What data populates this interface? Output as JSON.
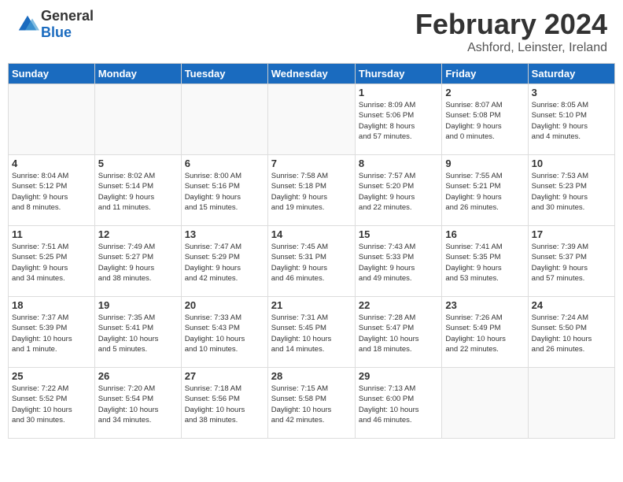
{
  "header": {
    "logo_general": "General",
    "logo_blue": "Blue",
    "month_year": "February 2024",
    "location": "Ashford, Leinster, Ireland"
  },
  "calendar": {
    "days_of_week": [
      "Sunday",
      "Monday",
      "Tuesday",
      "Wednesday",
      "Thursday",
      "Friday",
      "Saturday"
    ],
    "weeks": [
      [
        {
          "day": "",
          "info": ""
        },
        {
          "day": "",
          "info": ""
        },
        {
          "day": "",
          "info": ""
        },
        {
          "day": "",
          "info": ""
        },
        {
          "day": "1",
          "info": "Sunrise: 8:09 AM\nSunset: 5:06 PM\nDaylight: 8 hours\nand 57 minutes."
        },
        {
          "day": "2",
          "info": "Sunrise: 8:07 AM\nSunset: 5:08 PM\nDaylight: 9 hours\nand 0 minutes."
        },
        {
          "day": "3",
          "info": "Sunrise: 8:05 AM\nSunset: 5:10 PM\nDaylight: 9 hours\nand 4 minutes."
        }
      ],
      [
        {
          "day": "4",
          "info": "Sunrise: 8:04 AM\nSunset: 5:12 PM\nDaylight: 9 hours\nand 8 minutes."
        },
        {
          "day": "5",
          "info": "Sunrise: 8:02 AM\nSunset: 5:14 PM\nDaylight: 9 hours\nand 11 minutes."
        },
        {
          "day": "6",
          "info": "Sunrise: 8:00 AM\nSunset: 5:16 PM\nDaylight: 9 hours\nand 15 minutes."
        },
        {
          "day": "7",
          "info": "Sunrise: 7:58 AM\nSunset: 5:18 PM\nDaylight: 9 hours\nand 19 minutes."
        },
        {
          "day": "8",
          "info": "Sunrise: 7:57 AM\nSunset: 5:20 PM\nDaylight: 9 hours\nand 22 minutes."
        },
        {
          "day": "9",
          "info": "Sunrise: 7:55 AM\nSunset: 5:21 PM\nDaylight: 9 hours\nand 26 minutes."
        },
        {
          "day": "10",
          "info": "Sunrise: 7:53 AM\nSunset: 5:23 PM\nDaylight: 9 hours\nand 30 minutes."
        }
      ],
      [
        {
          "day": "11",
          "info": "Sunrise: 7:51 AM\nSunset: 5:25 PM\nDaylight: 9 hours\nand 34 minutes."
        },
        {
          "day": "12",
          "info": "Sunrise: 7:49 AM\nSunset: 5:27 PM\nDaylight: 9 hours\nand 38 minutes."
        },
        {
          "day": "13",
          "info": "Sunrise: 7:47 AM\nSunset: 5:29 PM\nDaylight: 9 hours\nand 42 minutes."
        },
        {
          "day": "14",
          "info": "Sunrise: 7:45 AM\nSunset: 5:31 PM\nDaylight: 9 hours\nand 46 minutes."
        },
        {
          "day": "15",
          "info": "Sunrise: 7:43 AM\nSunset: 5:33 PM\nDaylight: 9 hours\nand 49 minutes."
        },
        {
          "day": "16",
          "info": "Sunrise: 7:41 AM\nSunset: 5:35 PM\nDaylight: 9 hours\nand 53 minutes."
        },
        {
          "day": "17",
          "info": "Sunrise: 7:39 AM\nSunset: 5:37 PM\nDaylight: 9 hours\nand 57 minutes."
        }
      ],
      [
        {
          "day": "18",
          "info": "Sunrise: 7:37 AM\nSunset: 5:39 PM\nDaylight: 10 hours\nand 1 minute."
        },
        {
          "day": "19",
          "info": "Sunrise: 7:35 AM\nSunset: 5:41 PM\nDaylight: 10 hours\nand 5 minutes."
        },
        {
          "day": "20",
          "info": "Sunrise: 7:33 AM\nSunset: 5:43 PM\nDaylight: 10 hours\nand 10 minutes."
        },
        {
          "day": "21",
          "info": "Sunrise: 7:31 AM\nSunset: 5:45 PM\nDaylight: 10 hours\nand 14 minutes."
        },
        {
          "day": "22",
          "info": "Sunrise: 7:28 AM\nSunset: 5:47 PM\nDaylight: 10 hours\nand 18 minutes."
        },
        {
          "day": "23",
          "info": "Sunrise: 7:26 AM\nSunset: 5:49 PM\nDaylight: 10 hours\nand 22 minutes."
        },
        {
          "day": "24",
          "info": "Sunrise: 7:24 AM\nSunset: 5:50 PM\nDaylight: 10 hours\nand 26 minutes."
        }
      ],
      [
        {
          "day": "25",
          "info": "Sunrise: 7:22 AM\nSunset: 5:52 PM\nDaylight: 10 hours\nand 30 minutes."
        },
        {
          "day": "26",
          "info": "Sunrise: 7:20 AM\nSunset: 5:54 PM\nDaylight: 10 hours\nand 34 minutes."
        },
        {
          "day": "27",
          "info": "Sunrise: 7:18 AM\nSunset: 5:56 PM\nDaylight: 10 hours\nand 38 minutes."
        },
        {
          "day": "28",
          "info": "Sunrise: 7:15 AM\nSunset: 5:58 PM\nDaylight: 10 hours\nand 42 minutes."
        },
        {
          "day": "29",
          "info": "Sunrise: 7:13 AM\nSunset: 6:00 PM\nDaylight: 10 hours\nand 46 minutes."
        },
        {
          "day": "",
          "info": ""
        },
        {
          "day": "",
          "info": ""
        }
      ]
    ]
  }
}
